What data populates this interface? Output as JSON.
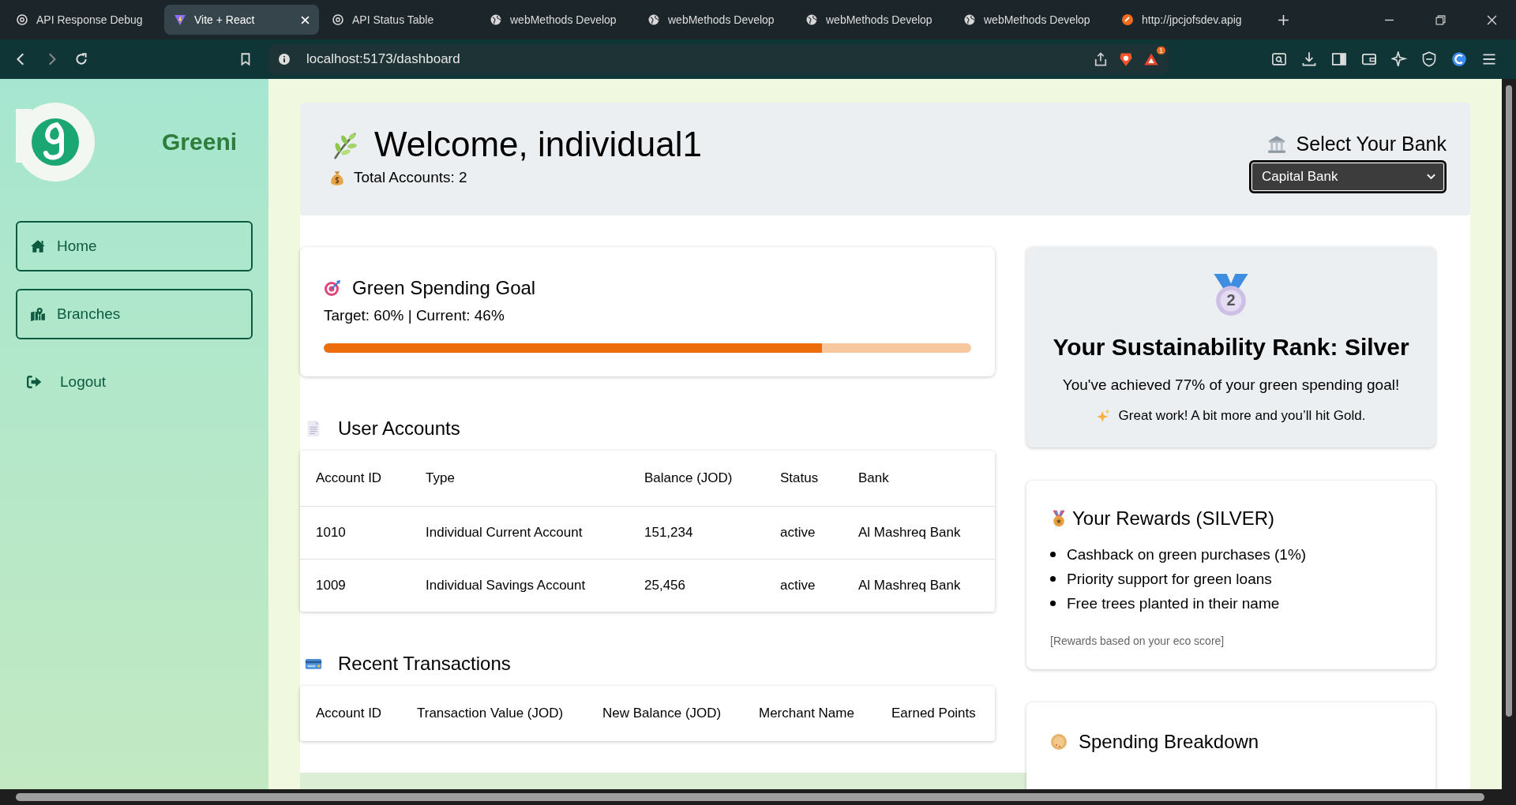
{
  "browser": {
    "tabs": [
      {
        "title": "API Response Debug",
        "selected": false,
        "kind": "swirl"
      },
      {
        "title": "Vite + React",
        "selected": true,
        "kind": "vite"
      },
      {
        "title": "API Status Table",
        "selected": false,
        "kind": "swirl"
      },
      {
        "title": "webMethods Develop",
        "selected": false,
        "kind": "globe"
      },
      {
        "title": "webMethods Develop",
        "selected": false,
        "kind": "globe"
      },
      {
        "title": "webMethods Develop",
        "selected": false,
        "kind": "globe"
      },
      {
        "title": "webMethods Develop",
        "selected": false,
        "kind": "globe"
      },
      {
        "title": "http://jpcjofsdev.apig",
        "selected": false,
        "kind": "gateway"
      }
    ],
    "url": "localhost:5173/dashboard",
    "shield_count": "1"
  },
  "sidebar": {
    "brand": "Greeni",
    "items": [
      {
        "label": "Home",
        "kind": "home",
        "boxed": true
      },
      {
        "label": "Branches",
        "kind": "map",
        "boxed": true
      },
      {
        "label": "Logout",
        "kind": "logout",
        "boxed": false
      }
    ]
  },
  "header": {
    "welcome": "Welcome, individual1",
    "total_accounts": "Total Accounts: 2",
    "bank_label": "Select Your Bank",
    "bank_value": "Capital Bank"
  },
  "goal": {
    "title": "Green Spending Goal",
    "summary": "Target: 60% | Current: 46%",
    "level": 0.77
  },
  "accounts": {
    "title": "User Accounts",
    "columns": [
      "Account ID",
      "Type",
      "Balance (JOD)",
      "Status",
      "Bank"
    ],
    "rows": [
      [
        "1010",
        "Individual Current Account",
        "151,234",
        "active",
        "Al Mashreq Bank"
      ],
      [
        "1009",
        "Individual Savings Account",
        "25,456",
        "active",
        "Al Mashreq Bank"
      ]
    ]
  },
  "transactions": {
    "title": "Recent Transactions",
    "columns": [
      "Account ID",
      "Transaction Value (JOD)",
      "New Balance (JOD)",
      "Merchant Name",
      "Earned Points"
    ]
  },
  "rank": {
    "medal": "2",
    "title": "Your Sustainability Rank: Silver",
    "message": "You've achieved 77% of your green spending goal!",
    "tip": "Great work! A bit more and you’ll hit Gold."
  },
  "rewards": {
    "title": "Your Rewards (SILVER)",
    "items": [
      "Cashback on green purchases (1%)",
      "Priority support for green loans",
      "Free trees planted in their name"
    ],
    "note": "[Rewards based on your eco score]"
  },
  "spending": {
    "title": "Spending Breakdown"
  }
}
